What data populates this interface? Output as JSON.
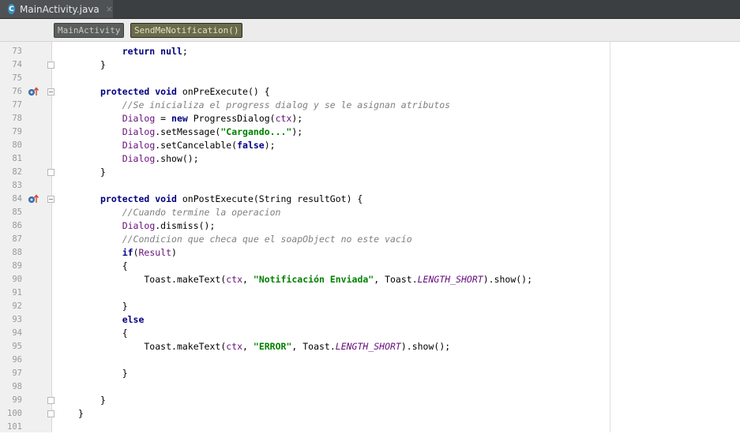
{
  "tab": {
    "title": "MainActivity.java",
    "icon_letter": "C",
    "close_glyph": "×"
  },
  "breadcrumbs": [
    "MainActivity",
    "SendMeNotification()"
  ],
  "gutter": {
    "line_numbers": [
      "73",
      "74",
      "75",
      "76",
      "77",
      "78",
      "79",
      "80",
      "81",
      "82",
      "83",
      "84",
      "85",
      "86",
      "87",
      "88",
      "89",
      "90",
      "91",
      "92",
      "93",
      "94",
      "95",
      "96",
      "97",
      "98",
      "99",
      "100",
      "101"
    ],
    "override_marks_at": [
      "76",
      "84"
    ]
  },
  "code": [
    [
      [
        "    return ",
        "kw"
      ],
      [
        "null",
        "kw"
      ],
      [
        ";",
        ""
      ]
    ],
    [
      [
        "}",
        ""
      ]
    ],
    [],
    [
      [
        "protected ",
        "kw"
      ],
      [
        "void ",
        "kw"
      ],
      [
        "onPreExecute() {",
        ""
      ]
    ],
    [
      [
        "    //Se inicializa el progress dialog y se le asignan atributos",
        "com"
      ]
    ],
    [
      [
        "    ",
        ""
      ],
      [
        "Dialog",
        "fld"
      ],
      [
        " = ",
        ""
      ],
      [
        "new ",
        "kw"
      ],
      [
        "ProgressDialog(",
        ""
      ],
      [
        "ctx",
        "fld"
      ],
      [
        ");",
        ""
      ]
    ],
    [
      [
        "    ",
        ""
      ],
      [
        "Dialog",
        "fld"
      ],
      [
        ".setMessage(",
        ""
      ],
      [
        "\"Cargando...\"",
        "str"
      ],
      [
        ");",
        ""
      ]
    ],
    [
      [
        "    ",
        ""
      ],
      [
        "Dialog",
        "fld"
      ],
      [
        ".setCancelable(",
        ""
      ],
      [
        "false",
        "kw"
      ],
      [
        ");",
        ""
      ]
    ],
    [
      [
        "    ",
        ""
      ],
      [
        "Dialog",
        "fld"
      ],
      [
        ".show();",
        ""
      ]
    ],
    [
      [
        "}",
        ""
      ]
    ],
    [],
    [
      [
        "protected ",
        "kw"
      ],
      [
        "void ",
        "kw"
      ],
      [
        "onPostExecute(String resultGot) {",
        ""
      ]
    ],
    [
      [
        "    //Cuando termine la operacion",
        "com"
      ]
    ],
    [
      [
        "    ",
        ""
      ],
      [
        "Dialog",
        "fld"
      ],
      [
        ".dismiss();",
        ""
      ]
    ],
    [
      [
        "    //Condicion que checa que el soapObject no este vacío",
        "com"
      ]
    ],
    [
      [
        "    ",
        ""
      ],
      [
        "if",
        "kw"
      ],
      [
        "(",
        ""
      ],
      [
        "Result",
        "fld"
      ],
      [
        ")",
        ""
      ]
    ],
    [
      [
        "    {",
        ""
      ]
    ],
    [
      [
        "        Toast.",
        ""
      ],
      [
        "makeText",
        "fn"
      ],
      [
        "(",
        ""
      ],
      [
        "ctx",
        "fld"
      ],
      [
        ", ",
        ""
      ],
      [
        "\"Notificación Enviada\"",
        "str"
      ],
      [
        ", Toast.",
        ""
      ],
      [
        "LENGTH_SHORT",
        "const"
      ],
      [
        ").show();",
        ""
      ]
    ],
    [],
    [
      [
        "    }",
        ""
      ]
    ],
    [
      [
        "    ",
        ""
      ],
      [
        "else",
        "kw"
      ]
    ],
    [
      [
        "    {",
        ""
      ]
    ],
    [
      [
        "        Toast.",
        ""
      ],
      [
        "makeText",
        "fn"
      ],
      [
        "(",
        ""
      ],
      [
        "ctx",
        "fld"
      ],
      [
        ", ",
        ""
      ],
      [
        "\"ERROR\"",
        "str"
      ],
      [
        ", Toast.",
        ""
      ],
      [
        "LENGTH_SHORT",
        "const"
      ],
      [
        ").show();",
        ""
      ]
    ],
    [],
    [
      [
        "    }",
        ""
      ]
    ],
    [],
    [
      [
        "}",
        ""
      ]
    ],
    [
      [
        "}",
        ""
      ]
    ],
    []
  ],
  "colors": {
    "keyword": "#000080",
    "field": "#660e7a",
    "string": "#008000",
    "comment": "#808080"
  }
}
